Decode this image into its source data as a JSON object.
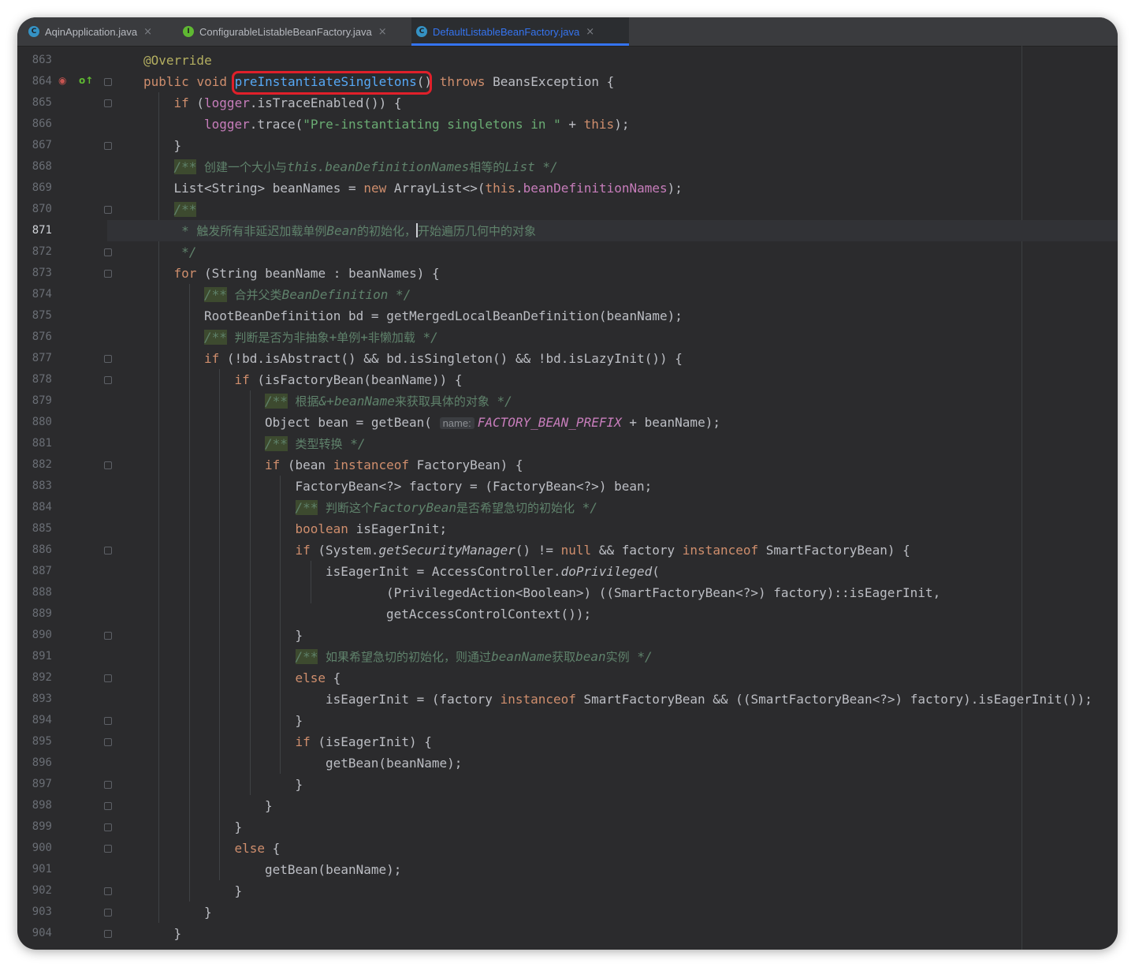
{
  "tabs": [
    {
      "label": "AqinApplication.java",
      "icon": "class-icon",
      "icon_glyph": "C",
      "color": "#3592c4",
      "active": false
    },
    {
      "label": "ConfigurableListableBeanFactory.java",
      "icon": "interface-icon",
      "icon_glyph": "I",
      "color": "#5fb832",
      "active": false
    },
    {
      "label": "DefaultListableBeanFactory.java",
      "icon": "class-icon",
      "icon_glyph": "C",
      "color": "#3592c4",
      "active": true
    }
  ],
  "close_glyph": "×",
  "current_line": 871,
  "lines": [
    {
      "n": 863,
      "t": "@Override"
    },
    {
      "n": 864,
      "t": "public void preInstantiateSingletons() throws BeansException {"
    },
    {
      "n": 865,
      "t": "if (logger.isTraceEnabled()) {"
    },
    {
      "n": 866,
      "t": "logger.trace(\"Pre-instantiating singletons in \" + this);"
    },
    {
      "n": 867,
      "t": "}"
    },
    {
      "n": 868,
      "t": "/** 创建一个大小与this.beanDefinitionNames相等的List */"
    },
    {
      "n": 869,
      "t": "List<String> beanNames = new ArrayList<>(this.beanDefinitionNames);"
    },
    {
      "n": 870,
      "t": "/**"
    },
    {
      "n": 871,
      "t": "* 触发所有非延迟加载单例Bean的初始化，开始遍历几何中的对象"
    },
    {
      "n": 872,
      "t": "*/"
    },
    {
      "n": 873,
      "t": "for (String beanName : beanNames) {"
    },
    {
      "n": 874,
      "t": "/** 合并父类BeanDefinition */"
    },
    {
      "n": 875,
      "t": "RootBeanDefinition bd = getMergedLocalBeanDefinition(beanName);"
    },
    {
      "n": 876,
      "t": "/** 判断是否为非抽象+单例+非懒加载 */"
    },
    {
      "n": 877,
      "t": "if (!bd.isAbstract() && bd.isSingleton() && !bd.isLazyInit()) {"
    },
    {
      "n": 878,
      "t": "if (isFactoryBean(beanName)) {"
    },
    {
      "n": 879,
      "t": "/** 根据&+beanName来获取具体的对象 */"
    },
    {
      "n": 880,
      "t": "Object bean = getBean( name: FACTORY_BEAN_PREFIX + beanName);"
    },
    {
      "n": 881,
      "t": "/** 类型转换 */"
    },
    {
      "n": 882,
      "t": "if (bean instanceof FactoryBean) {"
    },
    {
      "n": 883,
      "t": "FactoryBean<?> factory = (FactoryBean<?>) bean;"
    },
    {
      "n": 884,
      "t": "/** 判断这个FactoryBean是否希望急切的初始化 */"
    },
    {
      "n": 885,
      "t": "boolean isEagerInit;"
    },
    {
      "n": 886,
      "t": "if (System.getSecurityManager() != null && factory instanceof SmartFactoryBean) {"
    },
    {
      "n": 887,
      "t": "isEagerInit = AccessController.doPrivileged("
    },
    {
      "n": 888,
      "t": "(PrivilegedAction<Boolean>) ((SmartFactoryBean<?>) factory)::isEagerInit,"
    },
    {
      "n": 889,
      "t": "getAccessControlContext());"
    },
    {
      "n": 890,
      "t": "}"
    },
    {
      "n": 891,
      "t": "/** 如果希望急切的初始化，则通过beanName获取bean实例 */"
    },
    {
      "n": 892,
      "t": "else {"
    },
    {
      "n": 893,
      "t": "isEagerInit = (factory instanceof SmartFactoryBean && ((SmartFactoryBean<?>) factory).isEagerInit());"
    },
    {
      "n": 894,
      "t": "}"
    },
    {
      "n": 895,
      "t": "if (isEagerInit) {"
    },
    {
      "n": 896,
      "t": "getBean(beanName);"
    },
    {
      "n": 897,
      "t": "}"
    },
    {
      "n": 898,
      "t": "}"
    },
    {
      "n": 899,
      "t": "}"
    },
    {
      "n": 900,
      "t": "else {"
    },
    {
      "n": 901,
      "t": "getBean(beanName);"
    },
    {
      "n": 902,
      "t": "}"
    },
    {
      "n": 903,
      "t": "}"
    },
    {
      "n": 904,
      "t": "}"
    }
  ],
  "gutter_icons": [
    {
      "line": 864,
      "name": "debug-marker-icon",
      "glyph": "◉",
      "color": "#c75450"
    },
    {
      "line": 864,
      "name": "override-marker-icon",
      "glyph": "o↑",
      "color": "#5fb832"
    }
  ],
  "highlighted_method": "preInstantiateSingletons()",
  "colors": {
    "background": "#2b2b2d",
    "keyword": "#cf8e6d",
    "string": "#6aab73",
    "comment": "#5f826b",
    "field": "#c77dbb",
    "annotation": "#b3ae60",
    "accent": "#3574f0",
    "highlight_box": "#e0202a"
  }
}
